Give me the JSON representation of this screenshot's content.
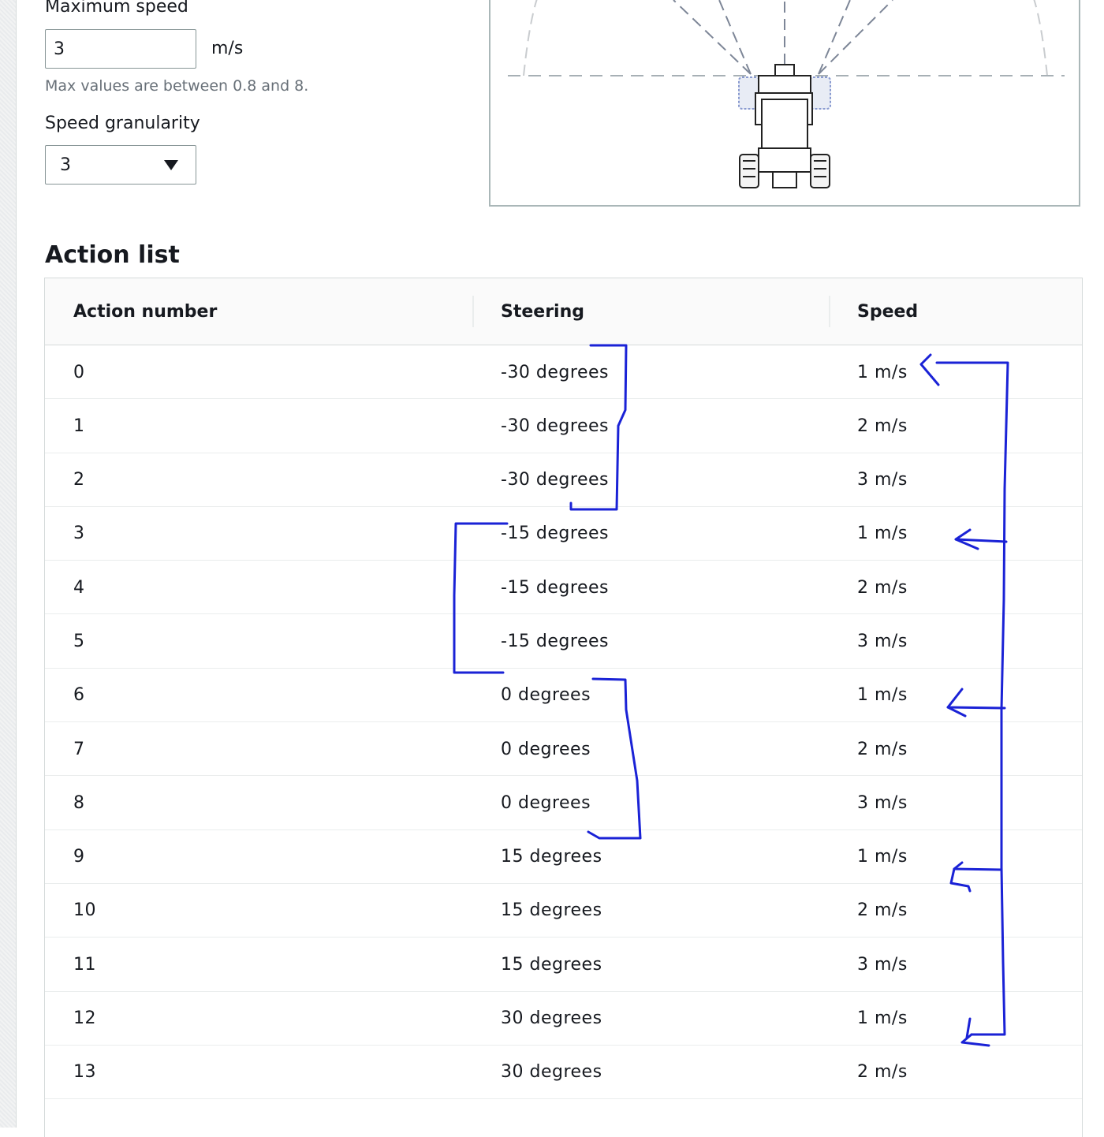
{
  "settings": {
    "max_speed_label": "Maximum speed",
    "max_speed_value": "3",
    "max_speed_unit": "m/s",
    "max_speed_hint": "Max values are between 0.8 and 8.",
    "granularity_label": "Speed granularity",
    "granularity_value": "3"
  },
  "action_list": {
    "title": "Action list",
    "columns": [
      "Action number",
      "Steering",
      "Speed"
    ],
    "rows": [
      {
        "action": "0",
        "steering": "-30 degrees",
        "speed": "1 m/s"
      },
      {
        "action": "1",
        "steering": "-30 degrees",
        "speed": "2 m/s"
      },
      {
        "action": "2",
        "steering": "-30 degrees",
        "speed": "3 m/s"
      },
      {
        "action": "3",
        "steering": "-15 degrees",
        "speed": "1 m/s"
      },
      {
        "action": "4",
        "steering": "-15 degrees",
        "speed": "2 m/s"
      },
      {
        "action": "5",
        "steering": "-15 degrees",
        "speed": "3 m/s"
      },
      {
        "action": "6",
        "steering": "0 degrees",
        "speed": "1 m/s"
      },
      {
        "action": "7",
        "steering": "0 degrees",
        "speed": "2 m/s"
      },
      {
        "action": "8",
        "steering": "0 degrees",
        "speed": "3 m/s"
      },
      {
        "action": "9",
        "steering": "15 degrees",
        "speed": "1 m/s"
      },
      {
        "action": "10",
        "steering": "15 degrees",
        "speed": "2 m/s"
      },
      {
        "action": "11",
        "steering": "15 degrees",
        "speed": "3 m/s"
      },
      {
        "action": "12",
        "steering": "30 degrees",
        "speed": "1 m/s"
      },
      {
        "action": "13",
        "steering": "30 degrees",
        "speed": "2 m/s"
      }
    ]
  },
  "colors": {
    "annotation_ink": "#1a22d6",
    "hint_text": "#687078",
    "border": "#d5dbdb"
  }
}
